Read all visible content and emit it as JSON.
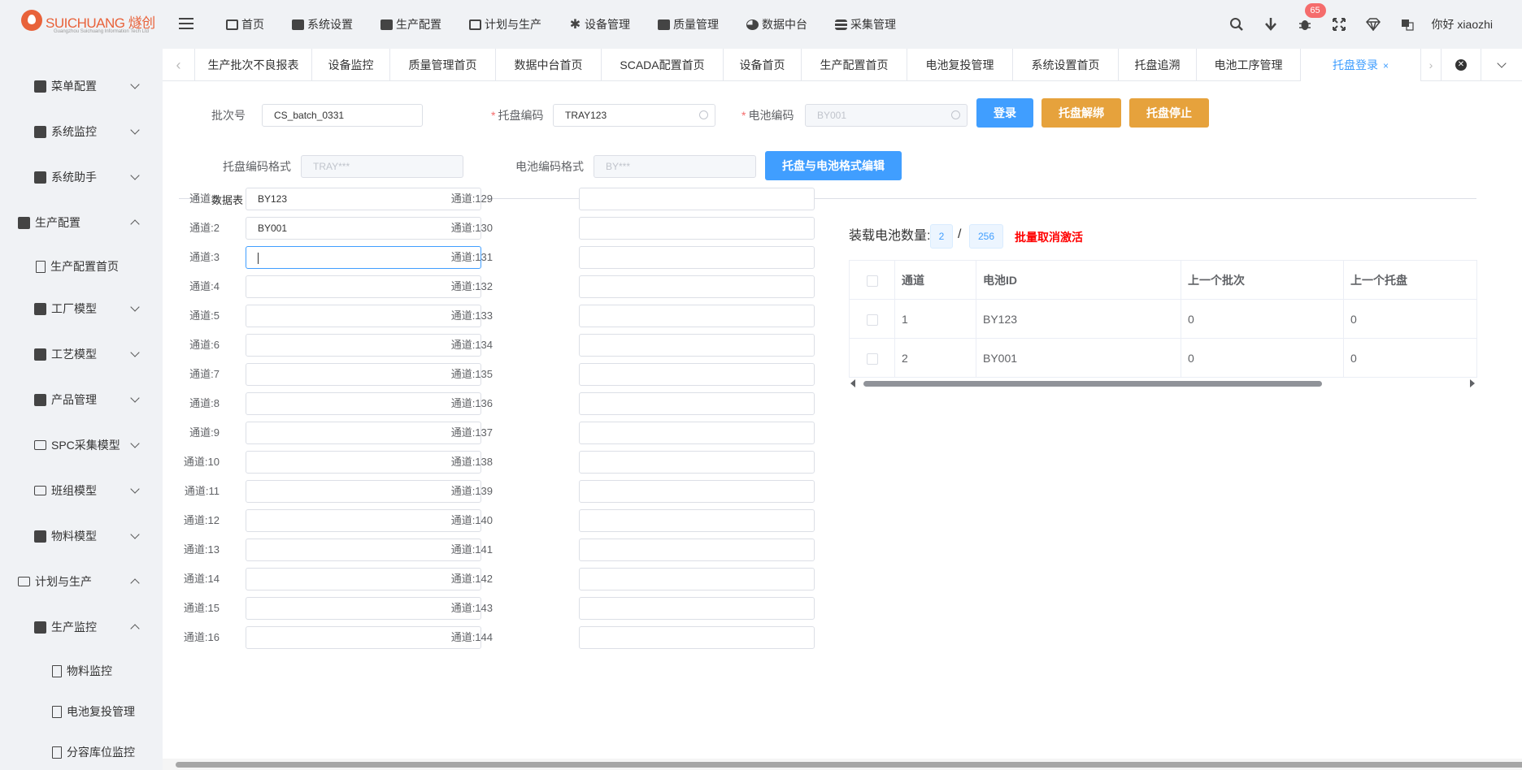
{
  "brand": {
    "name": "SUICHUANG 燧创",
    "subtitle": "Guangzhou Suichuang Information Tech Ltd"
  },
  "topnav": [
    {
      "label": "首页",
      "icon": "monitor-icon"
    },
    {
      "label": "系统设置",
      "icon": "user-settings-icon"
    },
    {
      "label": "生产配置",
      "icon": "briefcase-icon"
    },
    {
      "label": "计划与生产",
      "icon": "windows-icon"
    },
    {
      "label": "设备管理",
      "icon": "gear-icon"
    },
    {
      "label": "质量管理",
      "icon": "briefcase-icon"
    },
    {
      "label": "数据中台",
      "icon": "pie-chart-icon"
    },
    {
      "label": "采集管理",
      "icon": "database-icon"
    }
  ],
  "header": {
    "notification_count": "65",
    "greeting": "你好 xiaozhi"
  },
  "sidebar": {
    "items": [
      {
        "label": "菜单配置",
        "level": 1,
        "expanded": false
      },
      {
        "label": "系统监控",
        "level": 1,
        "expanded": false
      },
      {
        "label": "系统助手",
        "level": 1,
        "expanded": false
      },
      {
        "label": "生产配置",
        "level": 0,
        "expanded": true
      },
      {
        "label": "生产配置首页",
        "level": 1
      },
      {
        "label": "工厂模型",
        "level": 1,
        "expanded": false
      },
      {
        "label": "工艺模型",
        "level": 1,
        "expanded": false
      },
      {
        "label": "产品管理",
        "level": 1,
        "expanded": false
      },
      {
        "label": "SPC采集模型",
        "level": 1,
        "expanded": false
      },
      {
        "label": "班组模型",
        "level": 1,
        "expanded": false
      },
      {
        "label": "物料模型",
        "level": 1,
        "expanded": false
      },
      {
        "label": "计划与生产",
        "level": 0,
        "expanded": true
      },
      {
        "label": "生产监控",
        "level": 1,
        "expanded": true
      },
      {
        "label": "物料监控",
        "level": 2
      },
      {
        "label": "电池复投管理",
        "level": 2
      },
      {
        "label": "分容库位监控",
        "level": 2
      }
    ]
  },
  "tabs": [
    {
      "label": "生产批次不良报表"
    },
    {
      "label": "设备监控"
    },
    {
      "label": "质量管理首页"
    },
    {
      "label": "数据中台首页"
    },
    {
      "label": "SCADA配置首页"
    },
    {
      "label": "设备首页"
    },
    {
      "label": "生产配置首页"
    },
    {
      "label": "电池复投管理"
    },
    {
      "label": "系统设置首页"
    },
    {
      "label": "托盘追溯"
    },
    {
      "label": "电池工序管理"
    },
    {
      "label": "托盘登录",
      "active": true,
      "close": "×"
    }
  ],
  "form": {
    "batch_label": "批次号",
    "batch_value": "CS_batch_0331",
    "tray_code_label": "托盘编码",
    "tray_code_value": "TRAY123",
    "battery_code_label": "电池编码",
    "battery_code_placeholder": "BY001",
    "login_button": "登录",
    "unbind_button": "托盘解绑",
    "stop_button": "托盘停止",
    "tray_format_label": "托盘编码格式",
    "tray_format_placeholder": "TRAY***",
    "battery_format_label": "电池编码格式",
    "battery_format_placeholder": "BY***",
    "format_edit_button": "托盘与电池格式编辑",
    "required_mark": "*"
  },
  "section_title": "数据表",
  "channels_left": [
    {
      "label": "通道:1",
      "value": "BY123"
    },
    {
      "label": "通道:2",
      "value": "BY001"
    },
    {
      "label": "通道:3",
      "value": "",
      "focused": true
    },
    {
      "label": "通道:4",
      "value": ""
    },
    {
      "label": "通道:5",
      "value": ""
    },
    {
      "label": "通道:6",
      "value": ""
    },
    {
      "label": "通道:7",
      "value": ""
    },
    {
      "label": "通道:8",
      "value": ""
    },
    {
      "label": "通道:9",
      "value": ""
    },
    {
      "label": "通道:10",
      "value": ""
    },
    {
      "label": "通道:11",
      "value": ""
    },
    {
      "label": "通道:12",
      "value": ""
    },
    {
      "label": "通道:13",
      "value": ""
    },
    {
      "label": "通道:14",
      "value": ""
    },
    {
      "label": "通道:15",
      "value": ""
    },
    {
      "label": "通道:16",
      "value": ""
    }
  ],
  "channels_right": [
    {
      "label": "通道:129",
      "value": ""
    },
    {
      "label": "通道:130",
      "value": ""
    },
    {
      "label": "通道:131",
      "value": ""
    },
    {
      "label": "通道:132",
      "value": ""
    },
    {
      "label": "通道:133",
      "value": ""
    },
    {
      "label": "通道:134",
      "value": ""
    },
    {
      "label": "通道:135",
      "value": ""
    },
    {
      "label": "通道:136",
      "value": ""
    },
    {
      "label": "通道:137",
      "value": ""
    },
    {
      "label": "通道:138",
      "value": ""
    },
    {
      "label": "通道:139",
      "value": ""
    },
    {
      "label": "通道:140",
      "value": ""
    },
    {
      "label": "通道:141",
      "value": ""
    },
    {
      "label": "通道:142",
      "value": ""
    },
    {
      "label": "通道:143",
      "value": ""
    },
    {
      "label": "通道:144",
      "value": ""
    }
  ],
  "load": {
    "title": "装载电池数量:",
    "count": "2",
    "separator": "/",
    "total": "256",
    "batch_cancel": "批量取消激活"
  },
  "table": {
    "headers": [
      "通道",
      "电池ID",
      "上一个批次",
      "上一个托盘"
    ],
    "rows": [
      [
        "1",
        "BY123",
        "0",
        "0"
      ],
      [
        "2",
        "BY001",
        "0",
        "0"
      ]
    ]
  }
}
